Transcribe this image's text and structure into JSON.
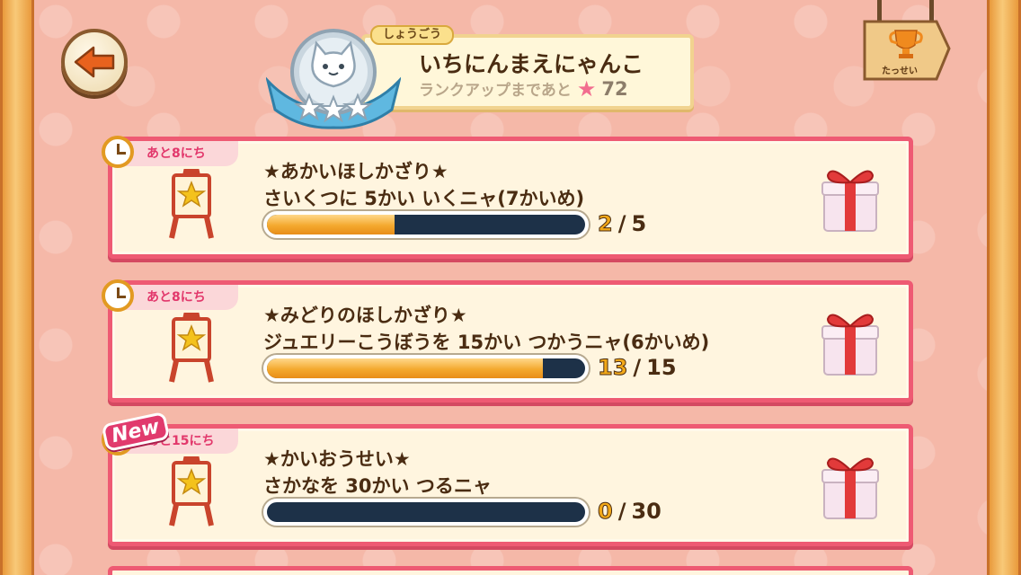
{
  "header": {
    "back_icon": "left-arrow-icon",
    "title_tag": "しょうごう",
    "title_name": "いちにんまえにゃんこ",
    "rank_text": "ランクアップまであと",
    "rank_value": "72",
    "trophy_label": "たっせい",
    "colors": {
      "accent": "#ee5a73",
      "progress": "#f4a92e"
    }
  },
  "missions": [
    {
      "deadline": "あと8にち",
      "title": "★あかいほしかざり★",
      "desc": "さいくつに 5かい いくニャ(7かいめ)",
      "current": "2",
      "sep": "/",
      "total": "5",
      "progress": 0.4,
      "new": false
    },
    {
      "deadline": "あと8にち",
      "title": "★みどりのほしかざり★",
      "desc": "ジュエリーこうぼうを 15かい つかうニャ(6かいめ)",
      "current": "13",
      "sep": "/",
      "total": "15",
      "progress": 0.8667,
      "new": false
    },
    {
      "deadline": "あと15にち",
      "title": "★かいおうせい★",
      "desc": "さかなを 30かい つるニャ",
      "current": "0",
      "sep": "/",
      "total": "30",
      "progress": 0,
      "new": true,
      "new_label": "New"
    }
  ]
}
